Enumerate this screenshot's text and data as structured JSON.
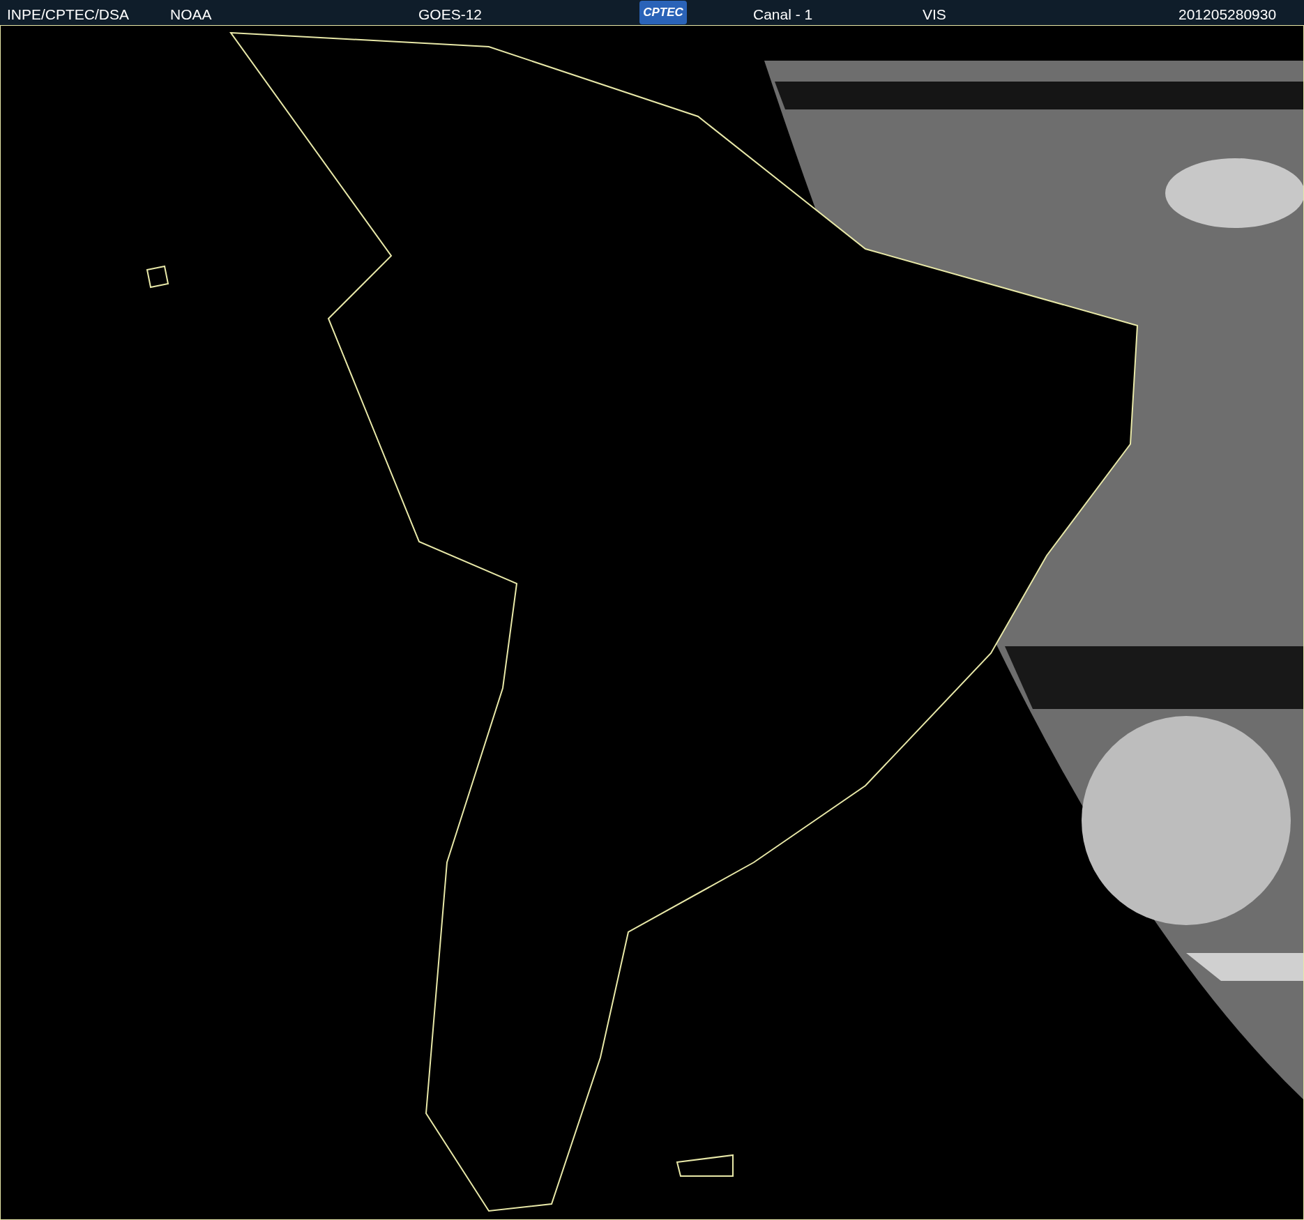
{
  "header": {
    "items": [
      {
        "kind": "text",
        "text": "INPE/CPTEC/DSA"
      },
      {
        "kind": "text",
        "text": "NOAA"
      },
      {
        "kind": "text",
        "text": "GOES-12"
      },
      {
        "kind": "logo",
        "text": "CPTEC"
      },
      {
        "kind": "text",
        "text": "Canal - 1"
      },
      {
        "kind": "text",
        "text": "VIS"
      },
      {
        "kind": "text",
        "text": "201205280930"
      }
    ]
  }
}
